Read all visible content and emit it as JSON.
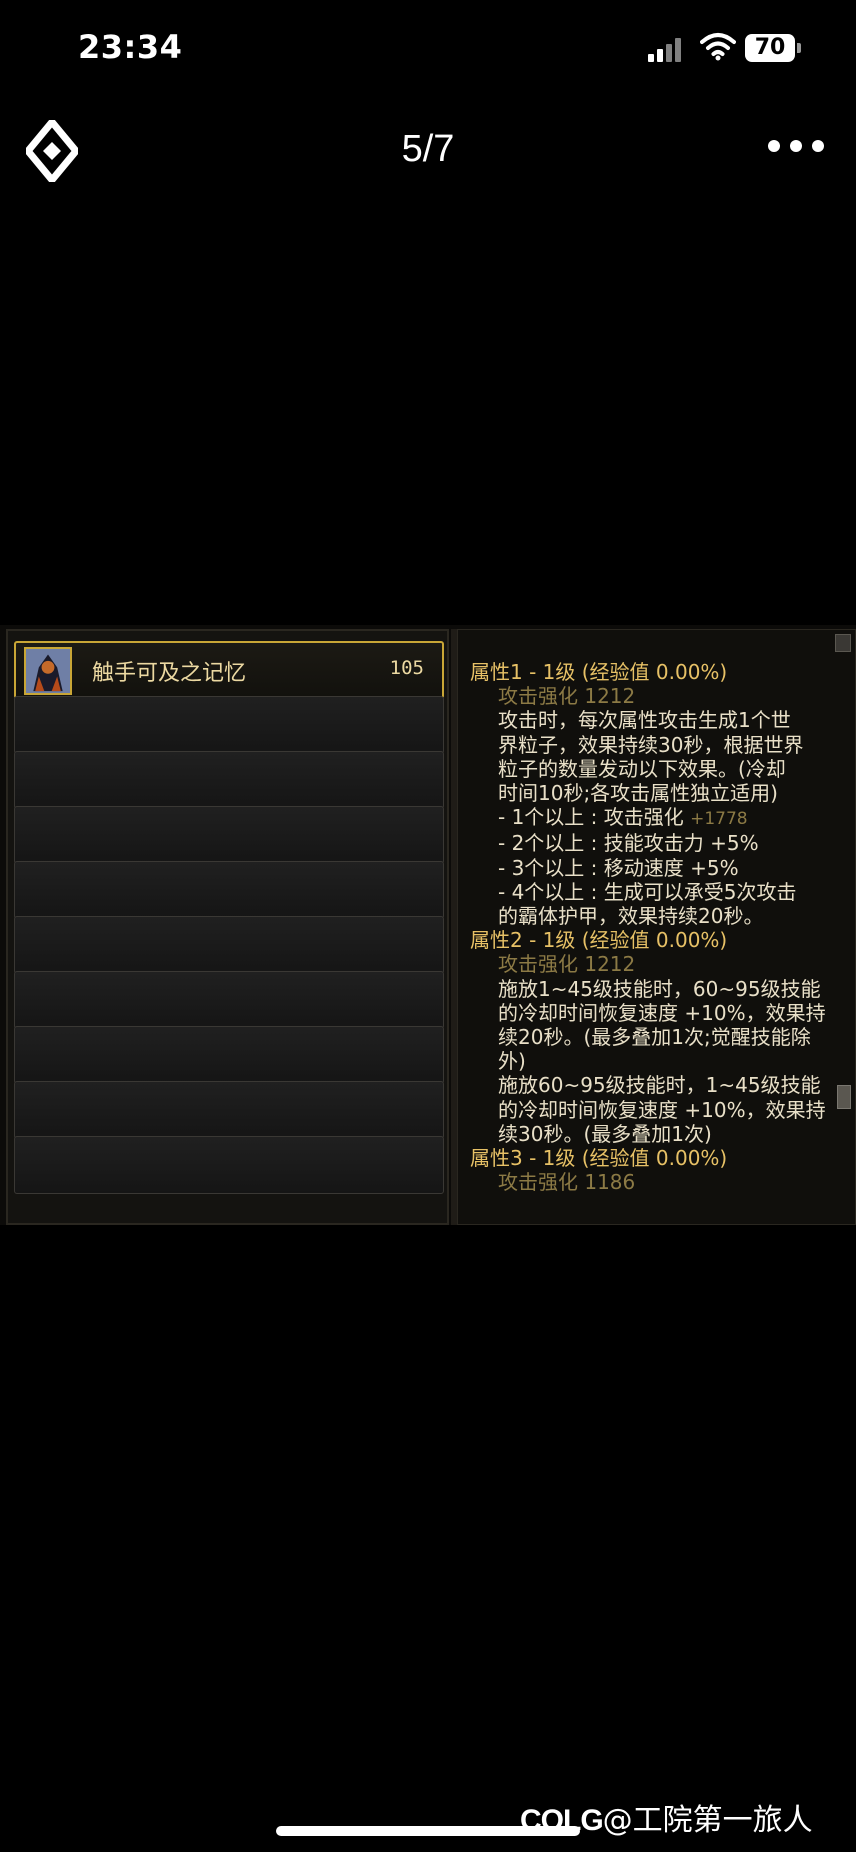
{
  "status_bar": {
    "time": "23:34",
    "battery": "70"
  },
  "nav": {
    "title": "5/7"
  },
  "game": {
    "slots": [
      {
        "name": "触手可及之记忆",
        "level": "105",
        "selected": true
      },
      {
        "name": "",
        "level": ""
      },
      {
        "name": "",
        "level": ""
      },
      {
        "name": "",
        "level": ""
      },
      {
        "name": "",
        "level": ""
      },
      {
        "name": "",
        "level": ""
      },
      {
        "name": "",
        "level": ""
      },
      {
        "name": "",
        "level": ""
      },
      {
        "name": "",
        "level": ""
      }
    ],
    "details": {
      "l1": "属性1 - 1级 (经验值 0.00%)",
      "l2": "攻击强化 1212",
      "l3": "攻击时，每次属性攻击生成1个世",
      "l4": "界粒子，效果持续30秒，根据世界",
      "l5": "粒子的数量发动以下效果。(冷却",
      "l6": "时间10秒;各攻击属性独立适用)",
      "l7a": "- 1个以上 : 攻击强化 ",
      "l7b": "+1778",
      "l8": "- 2个以上 : 技能攻击力 +5%",
      "l9": "- 3个以上 : 移动速度 +5%",
      "l10": "- 4个以上 : 生成可以承受5次攻击",
      "l11": "的霸体护甲，效果持续20秒。",
      "l12": "属性2 - 1级 (经验值 0.00%)",
      "l13": "攻击强化 1212",
      "l14": "施放1~45级技能时，60~95级技能",
      "l15": "的冷却时间恢复速度 +10%，效果持",
      "l16": "续20秒。(最多叠加1次;觉醒技能除",
      "l17": "外)",
      "l18": "施放60~95级技能时，1~45级技能",
      "l19": "的冷却时间恢复速度 +10%，效果持",
      "l20": "续30秒。(最多叠加1次)",
      "l21": "属性3 - 1级 (经验值 0.00%)",
      "l22": "攻击强化 1186"
    }
  },
  "watermark": {
    "brand": "COLG",
    "text": "@工院第一旅人"
  }
}
